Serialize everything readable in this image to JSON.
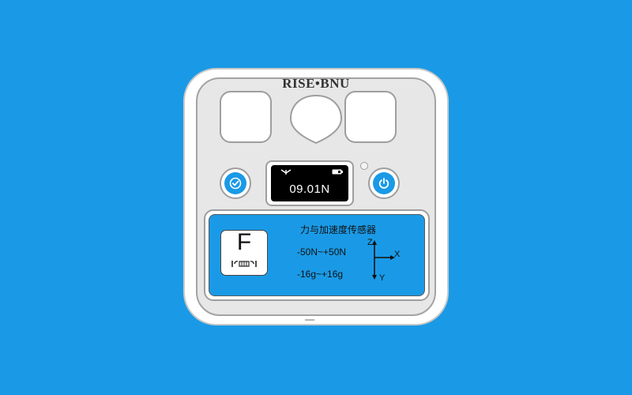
{
  "device": {
    "brand": "RISE•BNU",
    "display": {
      "reading": "09.01N",
      "signal_icon": "antenna-icon",
      "battery_icon": "battery-icon"
    },
    "buttons": {
      "left_icon": "check-icon",
      "right_icon": "power-icon"
    },
    "label": {
      "badge_letter": "F",
      "title": "力与加速度传感器",
      "force_range": "-50N~+50N",
      "accel_range": "-16g~+16g",
      "axis_z": "Z",
      "axis_x": "X",
      "axis_y": "Y"
    }
  },
  "colors": {
    "background": "#1a9ae6",
    "accent": "#1a9ae6",
    "screen": "#000000"
  }
}
